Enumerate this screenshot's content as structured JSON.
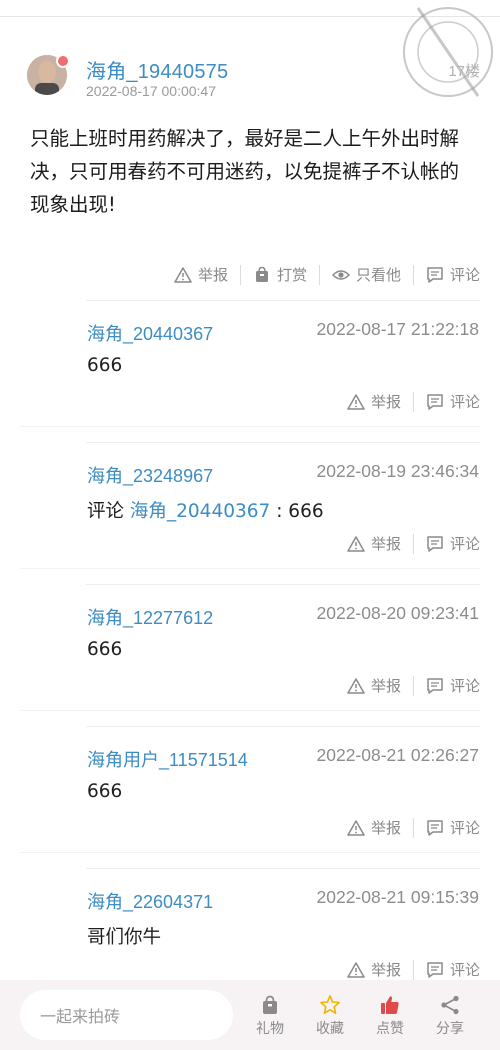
{
  "post": {
    "author": "海角_19440575",
    "time": "2022-08-17 00:00:47",
    "floor": "17楼",
    "content": "只能上班时用药解决了，最好是二人上午外出时解决，只可用春药不可用迷药，以免提裤子不认帐的现象出现!",
    "actions": {
      "report": "举报",
      "reward": "打赏",
      "only_him": "只看他",
      "comment": "评论"
    }
  },
  "replies": [
    {
      "user": "海角_20440367",
      "time": "2022-08-17 21:22:18",
      "prefix": "",
      "mention": "",
      "text": "666",
      "report": "举报",
      "comment": "评论"
    },
    {
      "user": "海角_23248967",
      "time": "2022-08-19 23:46:34",
      "prefix": "评论 ",
      "mention": "海角_20440367",
      "text": " : 666",
      "report": "举报",
      "comment": "评论"
    },
    {
      "user": "海角_12277612",
      "time": "2022-08-20 09:23:41",
      "prefix": "",
      "mention": "",
      "text": "666",
      "report": "举报",
      "comment": "评论"
    },
    {
      "user": "海角用户_11571514",
      "time": "2022-08-21 02:26:27",
      "prefix": "",
      "mention": "",
      "text": "666",
      "report": "举报",
      "comment": "评论"
    },
    {
      "user": "海角_22604371",
      "time": "2022-08-21 09:15:39",
      "prefix": "",
      "mention": "",
      "text": "哥们你牛",
      "report": "举报",
      "comment": "评论"
    }
  ],
  "bottom_bar": {
    "input_placeholder": "一起来拍砖",
    "gift": "礼物",
    "favorite": "收藏",
    "like": "点赞",
    "share": "分享"
  },
  "colors": {
    "link_blue": "#3e8cc4",
    "like_red": "#e04a4a",
    "favorite_yellow": "#f0b400"
  }
}
